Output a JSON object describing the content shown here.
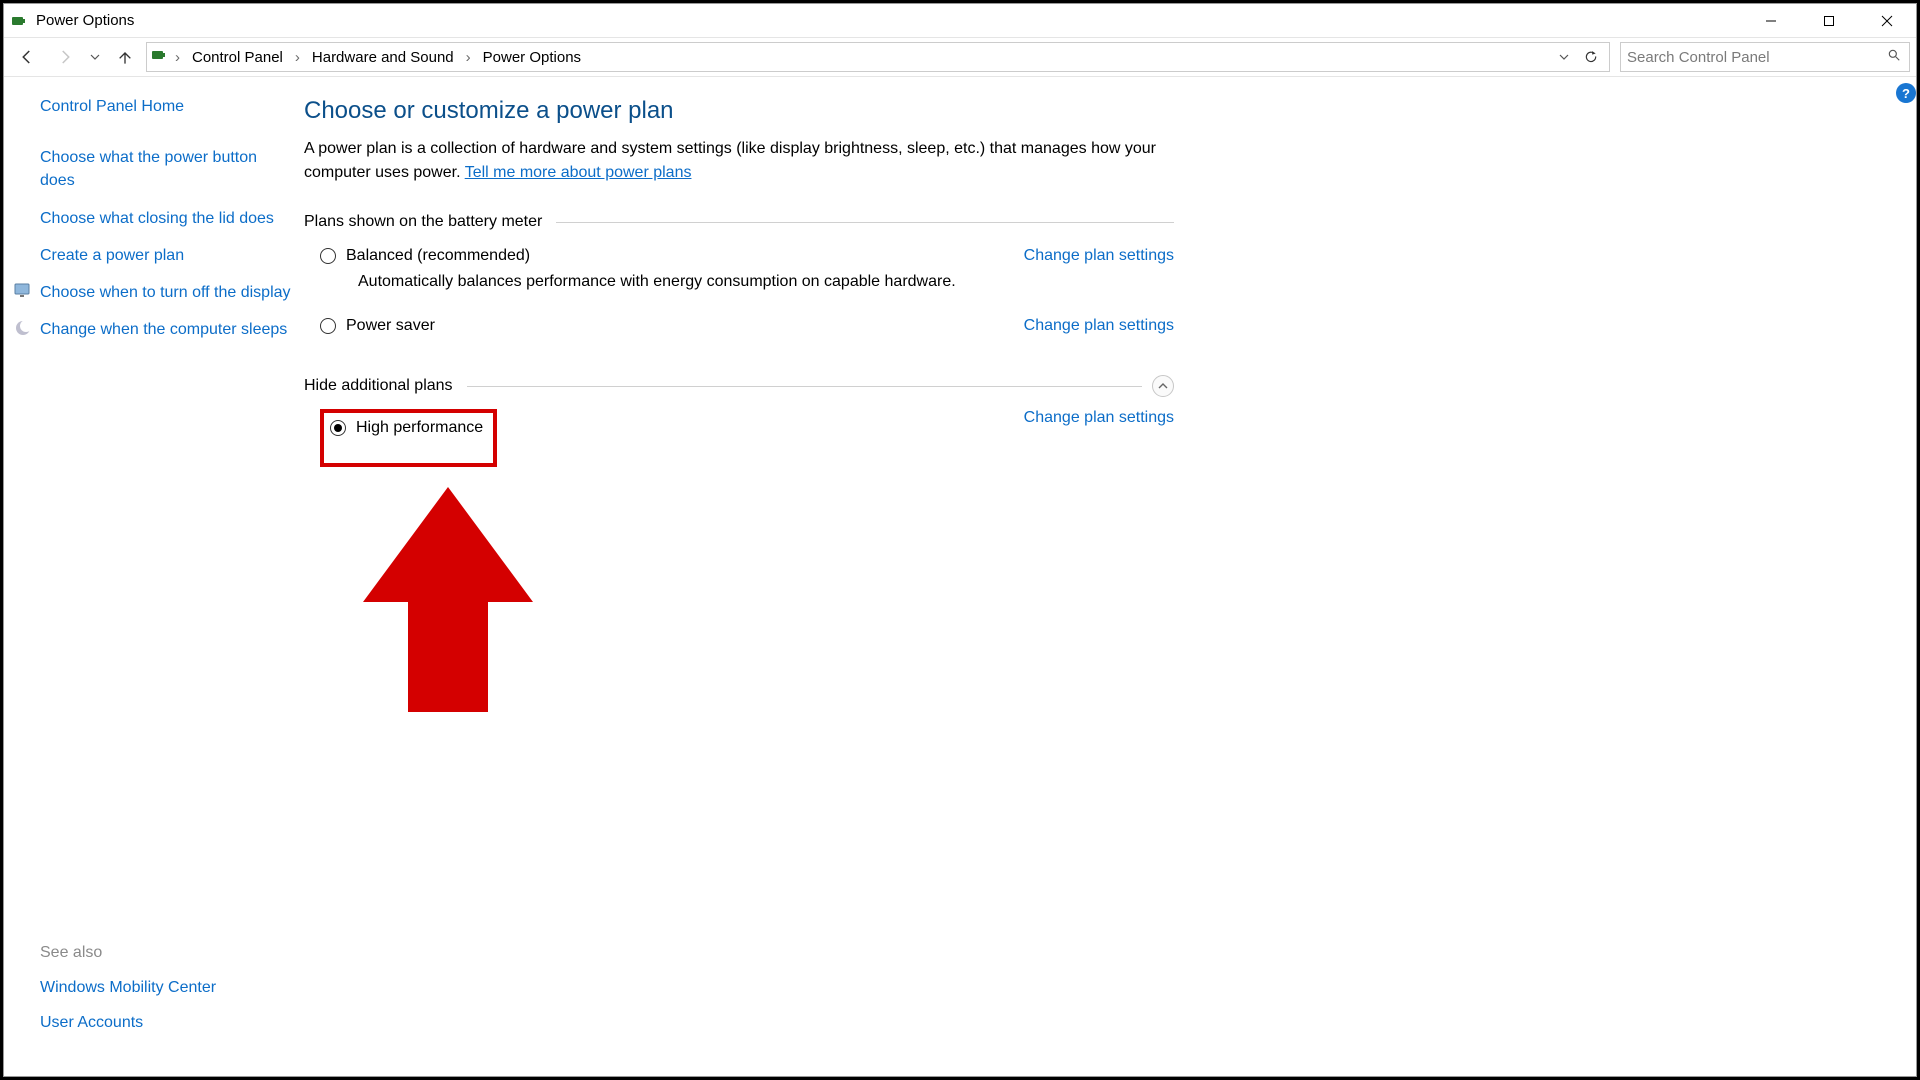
{
  "window": {
    "title": "Power Options"
  },
  "breadcrumbs": {
    "a": "Control Panel",
    "b": "Hardware and Sound",
    "c": "Power Options"
  },
  "search": {
    "placeholder": "Search Control Panel"
  },
  "sidebar": {
    "home": "Control Panel Home",
    "links": {
      "power_button": "Choose what the power button does",
      "close_lid": "Choose what closing the lid does",
      "create_plan": "Create a power plan",
      "turn_off_display": "Choose when to turn off the display",
      "computer_sleeps": "Change when the computer sleeps"
    }
  },
  "seealso": {
    "head": "See also",
    "mobility": "Windows Mobility Center",
    "accounts": "User Accounts"
  },
  "main": {
    "heading": "Choose or customize a power plan",
    "desc1": "A power plan is a collection of hardware and system settings (like display brightness, sleep, etc.) that manages how your computer uses power. ",
    "learn_more": "Tell me more about power plans",
    "group1": "Plans shown on the battery meter",
    "group2": "Hide additional plans",
    "plans": {
      "balanced": {
        "label": "Balanced (recommended)",
        "desc": "Automatically balances performance with energy consumption on capable hardware.",
        "change": "Change plan settings"
      },
      "saver": {
        "label": "Power saver",
        "change": "Change plan settings"
      },
      "high": {
        "label": "High performance",
        "change": "Change plan settings"
      }
    }
  }
}
